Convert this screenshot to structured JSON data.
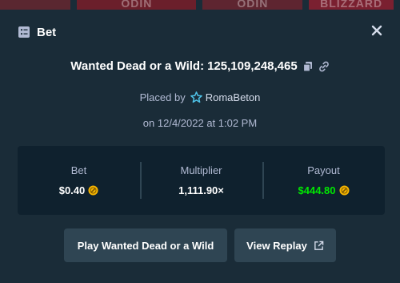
{
  "backdrop": {
    "thumbnails": [
      "",
      "ODIN",
      "ODIN",
      "BLIZZARD"
    ]
  },
  "modal": {
    "title": "Bet",
    "icon": "bet-slip-icon",
    "close_icon": "close-icon"
  },
  "bet": {
    "game": "Wanted Dead or a Wild",
    "separator": ":",
    "id": "125,109,248,465",
    "copy_icon": "copy-icon",
    "link_icon": "link-icon",
    "placed_by_label": "Placed by",
    "user": "RomaBeton",
    "user_icon": "vip-star-icon",
    "date_line": "on 12/4/2022 at 1:02 PM"
  },
  "stats": {
    "bet_label": "Bet",
    "bet_value": "$0.40",
    "multiplier_label": "Multiplier",
    "multiplier_value": "1,111.90×",
    "payout_label": "Payout",
    "payout_value": "$444.80",
    "coin_icon": "currency-coin-icon"
  },
  "actions": {
    "play_label": "Play Wanted Dead or a Wild",
    "replay_label": "View Replay",
    "replay_icon": "external-link-icon"
  },
  "colors": {
    "modal_bg": "#1a2c38",
    "panel_bg": "#0f212e",
    "button_bg": "#2f4553",
    "muted_text": "#b1bad3",
    "payout_green": "#00e701",
    "coin_gold": "#f5b400"
  }
}
